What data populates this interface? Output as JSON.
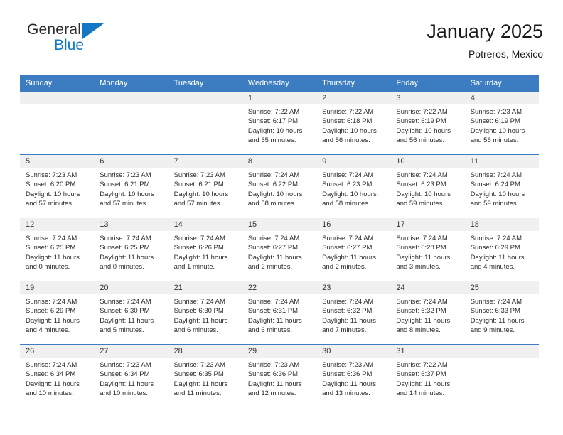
{
  "brand": {
    "name_primary": "General",
    "name_secondary": "Blue",
    "accent_color": "#1477c4"
  },
  "header": {
    "title": "January 2025",
    "subtitle": "Potreros, Mexico"
  },
  "theme": {
    "header_bg": "#3c7cc0",
    "day_band_bg": "#f0f0f0",
    "cell_bg": "#ffffff",
    "text_color": "#2b2b2b"
  },
  "weekdays": [
    "Sunday",
    "Monday",
    "Tuesday",
    "Wednesday",
    "Thursday",
    "Friday",
    "Saturday"
  ],
  "weeks": [
    [
      {
        "day": ""
      },
      {
        "day": ""
      },
      {
        "day": ""
      },
      {
        "day": "1",
        "sunrise": "Sunrise: 7:22 AM",
        "sunset": "Sunset: 6:17 PM",
        "daylight_l1": "Daylight: 10 hours",
        "daylight_l2": "and 55 minutes."
      },
      {
        "day": "2",
        "sunrise": "Sunrise: 7:22 AM",
        "sunset": "Sunset: 6:18 PM",
        "daylight_l1": "Daylight: 10 hours",
        "daylight_l2": "and 56 minutes."
      },
      {
        "day": "3",
        "sunrise": "Sunrise: 7:22 AM",
        "sunset": "Sunset: 6:19 PM",
        "daylight_l1": "Daylight: 10 hours",
        "daylight_l2": "and 56 minutes."
      },
      {
        "day": "4",
        "sunrise": "Sunrise: 7:23 AM",
        "sunset": "Sunset: 6:19 PM",
        "daylight_l1": "Daylight: 10 hours",
        "daylight_l2": "and 56 minutes."
      }
    ],
    [
      {
        "day": "5",
        "sunrise": "Sunrise: 7:23 AM",
        "sunset": "Sunset: 6:20 PM",
        "daylight_l1": "Daylight: 10 hours",
        "daylight_l2": "and 57 minutes."
      },
      {
        "day": "6",
        "sunrise": "Sunrise: 7:23 AM",
        "sunset": "Sunset: 6:21 PM",
        "daylight_l1": "Daylight: 10 hours",
        "daylight_l2": "and 57 minutes."
      },
      {
        "day": "7",
        "sunrise": "Sunrise: 7:23 AM",
        "sunset": "Sunset: 6:21 PM",
        "daylight_l1": "Daylight: 10 hours",
        "daylight_l2": "and 57 minutes."
      },
      {
        "day": "8",
        "sunrise": "Sunrise: 7:24 AM",
        "sunset": "Sunset: 6:22 PM",
        "daylight_l1": "Daylight: 10 hours",
        "daylight_l2": "and 58 minutes."
      },
      {
        "day": "9",
        "sunrise": "Sunrise: 7:24 AM",
        "sunset": "Sunset: 6:23 PM",
        "daylight_l1": "Daylight: 10 hours",
        "daylight_l2": "and 58 minutes."
      },
      {
        "day": "10",
        "sunrise": "Sunrise: 7:24 AM",
        "sunset": "Sunset: 6:23 PM",
        "daylight_l1": "Daylight: 10 hours",
        "daylight_l2": "and 59 minutes."
      },
      {
        "day": "11",
        "sunrise": "Sunrise: 7:24 AM",
        "sunset": "Sunset: 6:24 PM",
        "daylight_l1": "Daylight: 10 hours",
        "daylight_l2": "and 59 minutes."
      }
    ],
    [
      {
        "day": "12",
        "sunrise": "Sunrise: 7:24 AM",
        "sunset": "Sunset: 6:25 PM",
        "daylight_l1": "Daylight: 11 hours",
        "daylight_l2": "and 0 minutes."
      },
      {
        "day": "13",
        "sunrise": "Sunrise: 7:24 AM",
        "sunset": "Sunset: 6:25 PM",
        "daylight_l1": "Daylight: 11 hours",
        "daylight_l2": "and 0 minutes."
      },
      {
        "day": "14",
        "sunrise": "Sunrise: 7:24 AM",
        "sunset": "Sunset: 6:26 PM",
        "daylight_l1": "Daylight: 11 hours",
        "daylight_l2": "and 1 minute."
      },
      {
        "day": "15",
        "sunrise": "Sunrise: 7:24 AM",
        "sunset": "Sunset: 6:27 PM",
        "daylight_l1": "Daylight: 11 hours",
        "daylight_l2": "and 2 minutes."
      },
      {
        "day": "16",
        "sunrise": "Sunrise: 7:24 AM",
        "sunset": "Sunset: 6:27 PM",
        "daylight_l1": "Daylight: 11 hours",
        "daylight_l2": "and 2 minutes."
      },
      {
        "day": "17",
        "sunrise": "Sunrise: 7:24 AM",
        "sunset": "Sunset: 6:28 PM",
        "daylight_l1": "Daylight: 11 hours",
        "daylight_l2": "and 3 minutes."
      },
      {
        "day": "18",
        "sunrise": "Sunrise: 7:24 AM",
        "sunset": "Sunset: 6:29 PM",
        "daylight_l1": "Daylight: 11 hours",
        "daylight_l2": "and 4 minutes."
      }
    ],
    [
      {
        "day": "19",
        "sunrise": "Sunrise: 7:24 AM",
        "sunset": "Sunset: 6:29 PM",
        "daylight_l1": "Daylight: 11 hours",
        "daylight_l2": "and 4 minutes."
      },
      {
        "day": "20",
        "sunrise": "Sunrise: 7:24 AM",
        "sunset": "Sunset: 6:30 PM",
        "daylight_l1": "Daylight: 11 hours",
        "daylight_l2": "and 5 minutes."
      },
      {
        "day": "21",
        "sunrise": "Sunrise: 7:24 AM",
        "sunset": "Sunset: 6:30 PM",
        "daylight_l1": "Daylight: 11 hours",
        "daylight_l2": "and 6 minutes."
      },
      {
        "day": "22",
        "sunrise": "Sunrise: 7:24 AM",
        "sunset": "Sunset: 6:31 PM",
        "daylight_l1": "Daylight: 11 hours",
        "daylight_l2": "and 6 minutes."
      },
      {
        "day": "23",
        "sunrise": "Sunrise: 7:24 AM",
        "sunset": "Sunset: 6:32 PM",
        "daylight_l1": "Daylight: 11 hours",
        "daylight_l2": "and 7 minutes."
      },
      {
        "day": "24",
        "sunrise": "Sunrise: 7:24 AM",
        "sunset": "Sunset: 6:32 PM",
        "daylight_l1": "Daylight: 11 hours",
        "daylight_l2": "and 8 minutes."
      },
      {
        "day": "25",
        "sunrise": "Sunrise: 7:24 AM",
        "sunset": "Sunset: 6:33 PM",
        "daylight_l1": "Daylight: 11 hours",
        "daylight_l2": "and 9 minutes."
      }
    ],
    [
      {
        "day": "26",
        "sunrise": "Sunrise: 7:24 AM",
        "sunset": "Sunset: 6:34 PM",
        "daylight_l1": "Daylight: 11 hours",
        "daylight_l2": "and 10 minutes."
      },
      {
        "day": "27",
        "sunrise": "Sunrise: 7:23 AM",
        "sunset": "Sunset: 6:34 PM",
        "daylight_l1": "Daylight: 11 hours",
        "daylight_l2": "and 10 minutes."
      },
      {
        "day": "28",
        "sunrise": "Sunrise: 7:23 AM",
        "sunset": "Sunset: 6:35 PM",
        "daylight_l1": "Daylight: 11 hours",
        "daylight_l2": "and 11 minutes."
      },
      {
        "day": "29",
        "sunrise": "Sunrise: 7:23 AM",
        "sunset": "Sunset: 6:36 PM",
        "daylight_l1": "Daylight: 11 hours",
        "daylight_l2": "and 12 minutes."
      },
      {
        "day": "30",
        "sunrise": "Sunrise: 7:23 AM",
        "sunset": "Sunset: 6:36 PM",
        "daylight_l1": "Daylight: 11 hours",
        "daylight_l2": "and 13 minutes."
      },
      {
        "day": "31",
        "sunrise": "Sunrise: 7:22 AM",
        "sunset": "Sunset: 6:37 PM",
        "daylight_l1": "Daylight: 11 hours",
        "daylight_l2": "and 14 minutes."
      },
      {
        "day": ""
      }
    ]
  ]
}
